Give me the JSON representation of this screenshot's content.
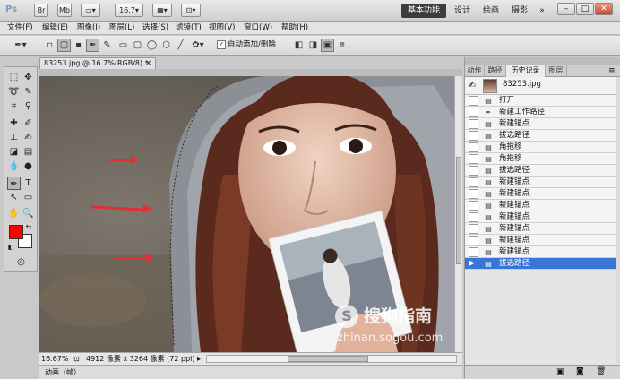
{
  "appbar": {
    "logo": "Ps",
    "br": "Br",
    "mb": "Mb",
    "zoom": "16.7",
    "workspaces": [
      "基本功能",
      "设计",
      "绘画",
      "摄影"
    ],
    "more": "»"
  },
  "menu": [
    "文件(F)",
    "编辑(E)",
    "图像(I)",
    "图层(L)",
    "选择(S)",
    "滤镜(T)",
    "视图(V)",
    "窗口(W)",
    "帮助(H)"
  ],
  "options": {
    "auto_add_delete_checked": true,
    "auto_add_delete_label": "自动添加/删除"
  },
  "document": {
    "tab_title": "83253.jpg @ 16.7%(RGB/8) *",
    "zoom": "16.67%",
    "info": "4912 像素 x 3264 像素 (72 ppi)",
    "timeline": "动画（帧）"
  },
  "panel": {
    "tabs": [
      "动作",
      "路径",
      "历史记录",
      "图层"
    ],
    "active_tab": 2,
    "snapshot_name": "83253.jpg",
    "history": [
      "打开",
      "新建工作路径",
      "新建锚点",
      "拔选路径",
      "角拖移",
      "角拖移",
      "拔选路径",
      "新建锚点",
      "新建锚点",
      "新建锚点",
      "新建锚点",
      "新建锚点",
      "新建锚点",
      "新建锚点",
      "拔选路径"
    ],
    "history_icons": [
      "doc-icon",
      "pen-icon",
      "doc-icon",
      "doc-icon",
      "doc-icon",
      "doc-icon",
      "doc-icon",
      "doc-icon",
      "doc-icon",
      "doc-icon",
      "doc-icon",
      "doc-icon",
      "doc-icon",
      "doc-icon",
      "doc-icon"
    ],
    "selected_index": 14
  },
  "watermark": {
    "brand": "搜狗指南",
    "url": "zhinan.sogou.com"
  },
  "colors": {
    "foreground": "#ff0000",
    "background": "#ffffff",
    "selection": "#3875d7",
    "arrows": "#e03030"
  }
}
